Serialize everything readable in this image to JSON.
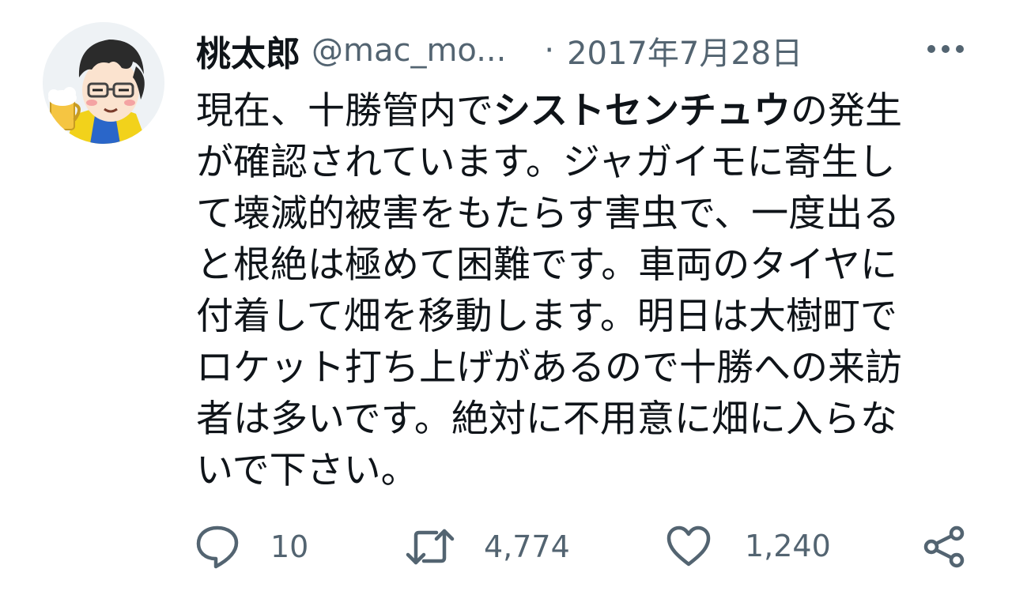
{
  "tweet": {
    "display_name": "桃太郎",
    "handle": "@mac_mo...",
    "separator": "·",
    "date": "2017年7月28日",
    "body_lines": [
      {
        "before": "現在、十勝管内で",
        "bold": "シストセンチュウ",
        "after": "の発生"
      },
      {
        "text": "が確認されています。ジャガイモに寄生し"
      },
      {
        "text": "て壊滅的被害をもたらす害虫で、一度出る"
      },
      {
        "text": "と根絶は極めて困難です。車両のタイヤに"
      },
      {
        "text": "付着して畑を移動します。明日は大樹町で"
      },
      {
        "text": "ロケット打ち上げがあるので十勝への来訪"
      },
      {
        "text": "者は多いです。絶対に不用意に畑に入らな"
      },
      {
        "text": "いで下さい。"
      }
    ]
  },
  "actions": {
    "reply": {
      "icon": "reply-icon",
      "count": "10"
    },
    "retweet": {
      "icon": "retweet-icon",
      "count": "4,774"
    },
    "like": {
      "icon": "heart-icon",
      "count": "1,240"
    },
    "share": {
      "icon": "share-icon"
    }
  },
  "colors": {
    "text_primary": "#0f1419",
    "text_secondary": "#536471",
    "background": "#ffffff"
  }
}
